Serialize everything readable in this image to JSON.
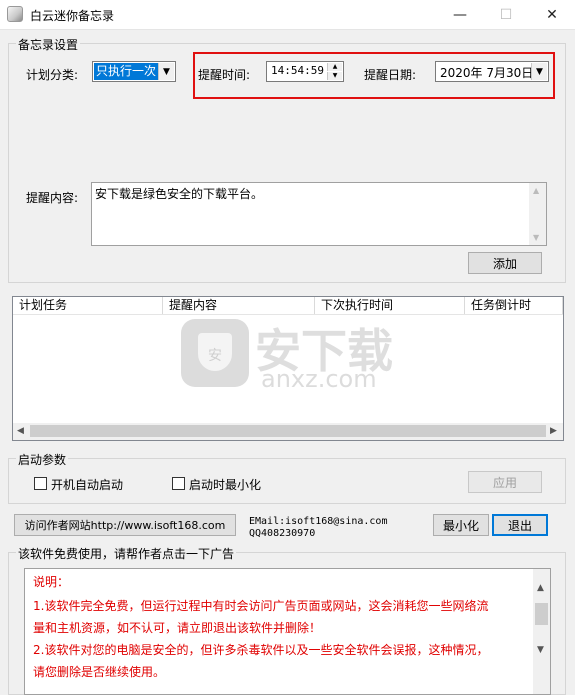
{
  "window": {
    "title": "白云迷你备忘录",
    "minimize_glyph": "—",
    "maximize_glyph": "☐",
    "close_glyph": "✕"
  },
  "settings": {
    "legend": "备忘录设置",
    "category_label": "计划分类:",
    "category_value": "只执行一次",
    "remind_time_label": "提醒时间:",
    "remind_time_value": "14:54:59",
    "remind_date_label": "提醒日期:",
    "remind_date_value": "2020年 7月30日",
    "content_label": "提醒内容:",
    "content_value": "安下载是绿色安全的下载平台。",
    "add_button": "添加"
  },
  "task_table": {
    "columns": [
      "计划任务",
      "提醒内容",
      "下次执行时间",
      "任务倒计时"
    ],
    "rows": []
  },
  "startup": {
    "legend": "启动参数",
    "autostart_label": "开机自动启动",
    "autostart_checked": false,
    "minimized_label": "启动时最小化",
    "minimized_checked": false,
    "apply_button": "应用"
  },
  "footer": {
    "visit_button": "访问作者网站http://www.isoft168.com",
    "email_text": "EMail:isoft168@sina.com",
    "qq_text": "QQ408230970",
    "minimize_button": "最小化",
    "exit_button": "退出"
  },
  "ad": {
    "legend": "该软件免费使用，请帮作者点击一下广告",
    "lines": [
      "说明：",
      "1.该软件完全免费，但运行过程中有时会访问广告页面或网站，这会消耗您一些网络流",
      "量和主机资源，如不认可，请立即退出该软件并删除！",
      "2.该软件对您的电脑是安全的，但许多杀毒软件以及一些安全软件会误报，这种情况，",
      "请您删除是否继续使用。"
    ]
  },
  "watermark": {
    "brand_text": "安下载",
    "domain_text": "anxz.com"
  },
  "colors": {
    "highlight_frame": "#e01010",
    "selection": "#0078d7",
    "ad_text": "#e00000"
  }
}
